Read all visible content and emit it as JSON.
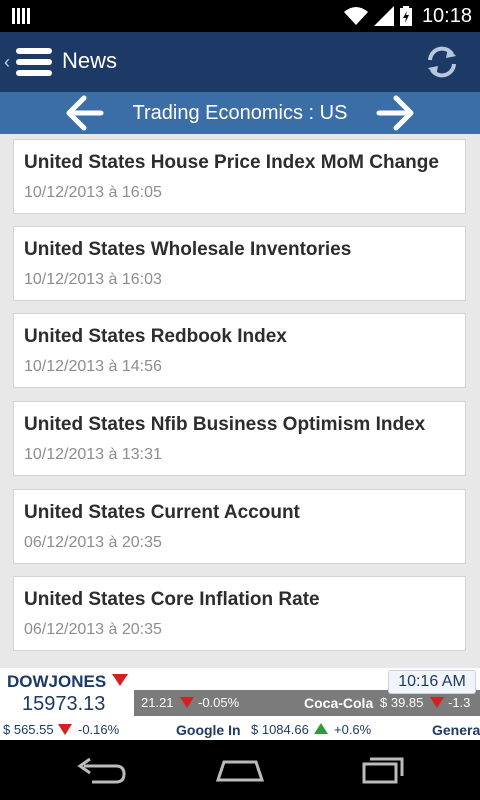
{
  "status_bar": {
    "time": "10:18"
  },
  "app_bar": {
    "title": "News"
  },
  "sub_bar": {
    "title": "Trading Economics : US"
  },
  "news_items": [
    {
      "headline": "United States House Price Index MoM Change",
      "date": "10/12/2013 à 16:05"
    },
    {
      "headline": "United States Wholesale Inventories",
      "date": "10/12/2013 à 16:03"
    },
    {
      "headline": "United States Redbook Index",
      "date": "10/12/2013 à 14:56"
    },
    {
      "headline": "United States Nfib Business Optimism Index",
      "date": "10/12/2013 à 13:31"
    },
    {
      "headline": "United States Current Account",
      "date": "06/12/2013 à 20:35"
    },
    {
      "headline": "United States Core Inflation Rate",
      "date": "06/12/2013 à 20:35"
    }
  ],
  "ticker": {
    "index_name": "DOWJONES",
    "index_value": "15973.13",
    "time": "10:16 AM",
    "strip_prev_value": "21.21",
    "strip_prev_change": "-0.05%",
    "strip_name": "Coca-Cola",
    "strip_price": "$ 39.85",
    "strip_change": "-1.3",
    "row_prev_price": "$ 565.55",
    "row_prev_change": "-0.16%",
    "row_name": "Google In",
    "row_price": "$ 1084.66",
    "row_change": "+0.6%",
    "row_next_name": "Genera"
  },
  "colors": {
    "app_bar": "#1d3a66",
    "sub_bar": "#3b6ea7",
    "down": "#d42020",
    "up": "#2e9a3a"
  }
}
